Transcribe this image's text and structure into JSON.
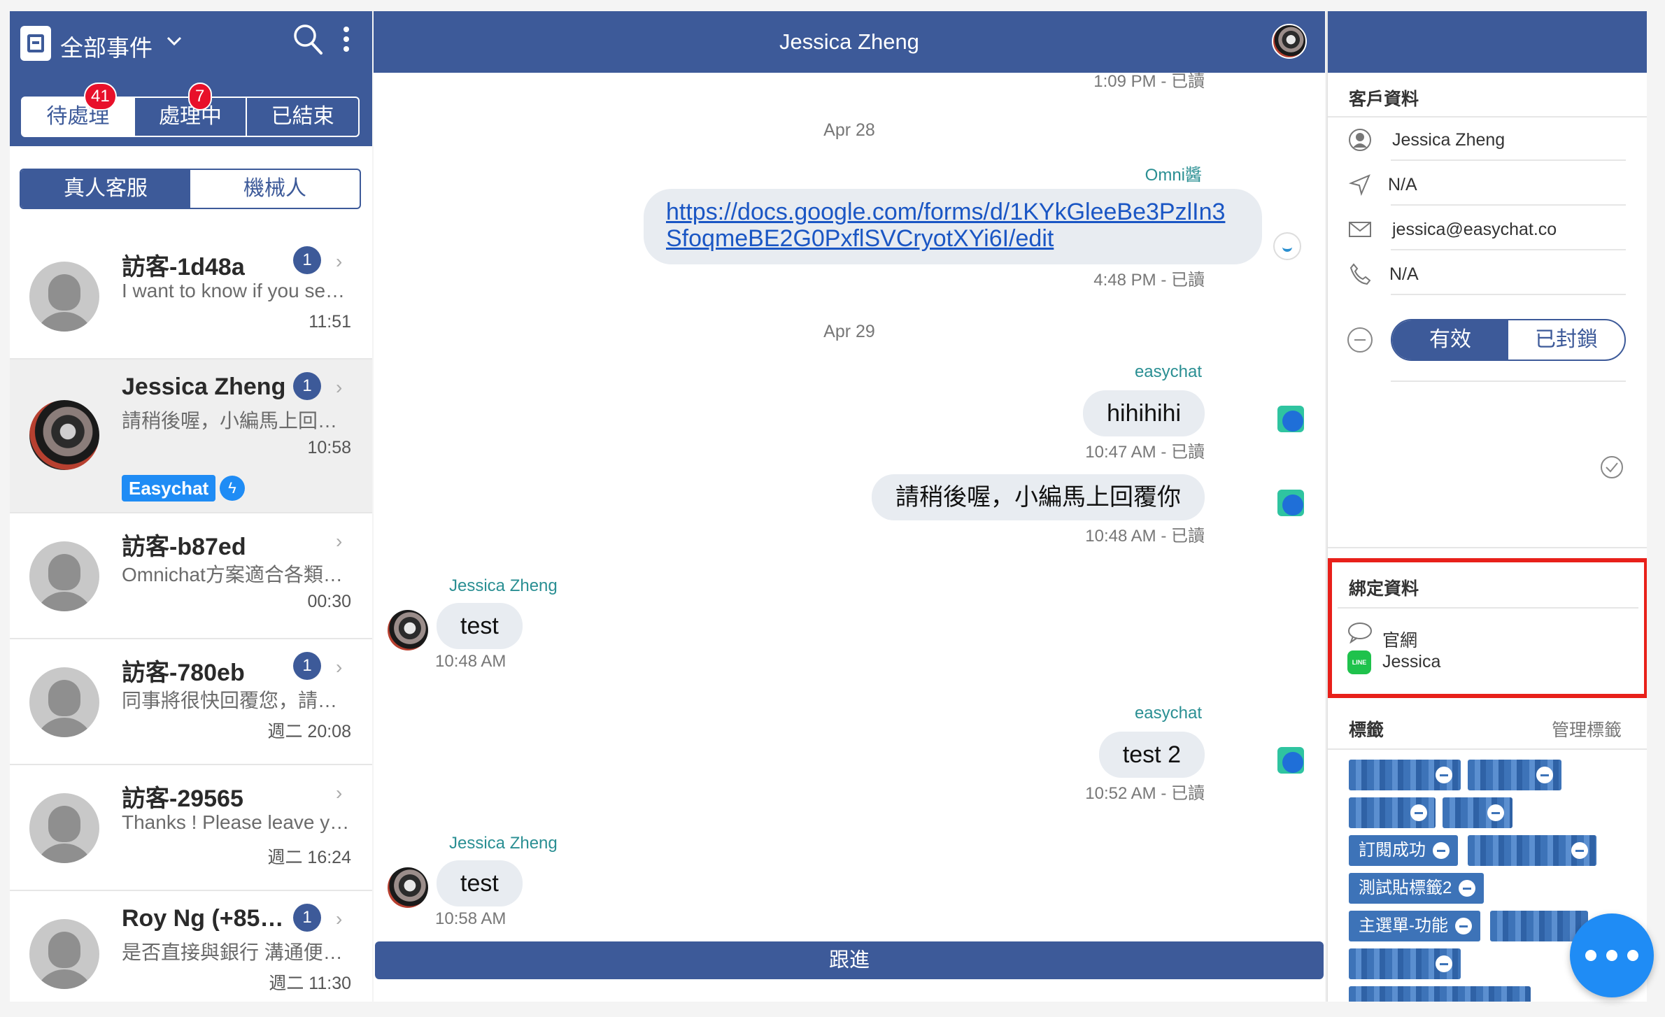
{
  "left": {
    "title": "全部事件",
    "status_tabs": [
      {
        "label": "待處理",
        "badge": "41"
      },
      {
        "label": "處理中",
        "badge": "7"
      },
      {
        "label": "已結束",
        "badge": ""
      }
    ],
    "type_tabs": [
      {
        "label": "真人客服"
      },
      {
        "label": "機械人"
      }
    ],
    "conversations": [
      {
        "name": "訪客-1d48a",
        "unread": "1",
        "preview": "I want to know if you se…",
        "time": "11:51"
      },
      {
        "name": "Jessica Zheng",
        "unread": "1",
        "preview": "請稍後喔，小編馬上回…",
        "time": "10:58",
        "channel": "Easychat"
      },
      {
        "name": "訪客-b87ed",
        "unread": "",
        "preview": "Omnichat方案適合各類…",
        "time": "00:30"
      },
      {
        "name": "訪客-780eb",
        "unread": "1",
        "preview": "同事將很快回覆您，請…",
        "time": "週二 20:08"
      },
      {
        "name": "訪客-29565",
        "unread": "",
        "preview": "Thanks ! Please leave y…",
        "time": "週二 16:24"
      },
      {
        "name": "Roy Ng (+852…",
        "unread": "1",
        "preview": "是否直接與銀行 溝通便…",
        "time": "週二 11:30"
      }
    ]
  },
  "chat": {
    "title": "Jessica Zheng",
    "top_meta": "1:09 PM - 已讀",
    "date1": "Apr 28",
    "m1_sender": "Omni醬",
    "m1_link": "https://docs.google.com/forms/d/1KYkGleeBe3PzlIn3SfoqmeBE2G0PxflSVCryotXYi6I/edit",
    "m1_meta": "4:48 PM - 已讀",
    "date2": "Apr 29",
    "m2_sender": "easychat",
    "m2_text": "hihihihi",
    "m2_meta": "10:47 AM - 已讀",
    "m3_text": "請稍後喔，小編馬上回覆你",
    "m3_meta": "10:48 AM - 已讀",
    "m4_sender": "Jessica Zheng",
    "m4_text": "test",
    "m4_meta": "10:48 AM",
    "m5_sender": "easychat",
    "m5_text": "test 2",
    "m5_meta": "10:52 AM - 已讀",
    "m6_sender": "Jessica Zheng",
    "m6_text": "test",
    "m6_meta": "10:58 AM",
    "follow_label": "跟進"
  },
  "profile": {
    "section_title": "客戶資料",
    "name": "Jessica Zheng",
    "location": "N/A",
    "email": "jessica@easychat.co",
    "phone": "N/A",
    "status_options": [
      "有效",
      "已封鎖"
    ],
    "bind_title": "綁定資料",
    "bind_web": "官網",
    "bind_line": "Jessica",
    "tags_title": "標籤",
    "manage_tags": "管理標籤",
    "tags": [
      "訂閱成功",
      "測試貼標籤2",
      "主選單-功能"
    ]
  },
  "colors": {
    "brand": "#3d5a99",
    "badge": "#e8102a",
    "highlight_box": "#e8201a",
    "tag": "#3d73b8",
    "fab": "#1f8cf5"
  }
}
